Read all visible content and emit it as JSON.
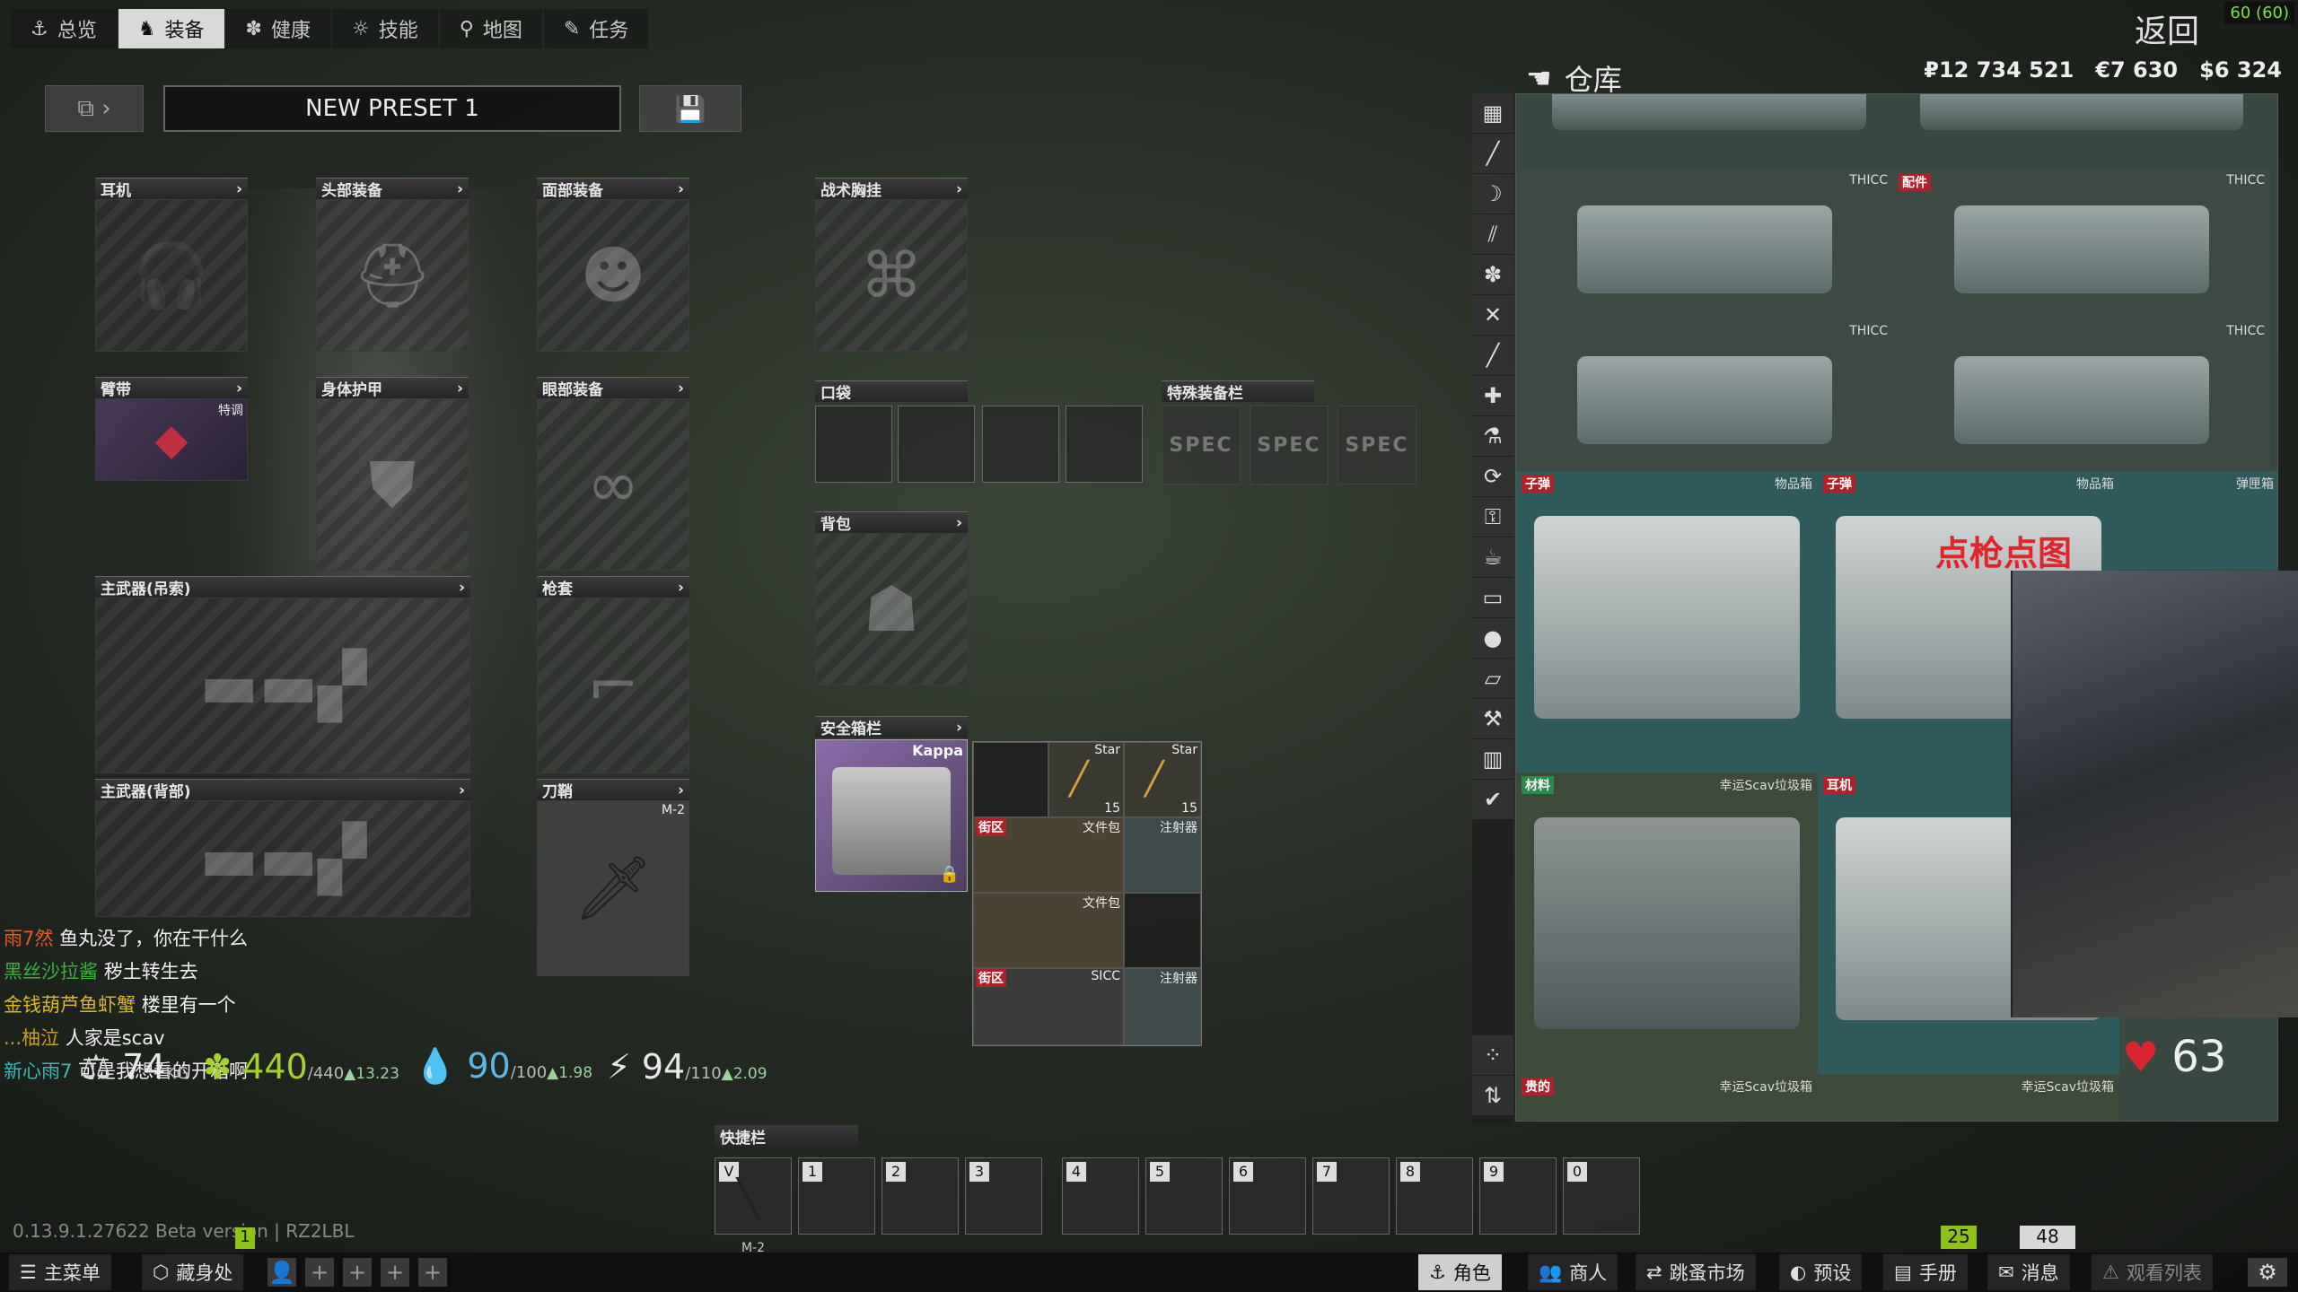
{
  "nav": {
    "tabs": [
      {
        "label": "总览",
        "icon": "overview-icon",
        "glyph": "⚓"
      },
      {
        "label": "装备",
        "icon": "gear-icon",
        "glyph": "♞"
      },
      {
        "label": "健康",
        "icon": "health-icon",
        "glyph": "✽"
      },
      {
        "label": "技能",
        "icon": "skills-icon",
        "glyph": "☼"
      },
      {
        "label": "地图",
        "icon": "map-pin-icon",
        "glyph": "⚲"
      },
      {
        "label": "任务",
        "icon": "tasks-icon",
        "glyph": "✎"
      }
    ],
    "back": "返回",
    "fps": "60 (60)"
  },
  "preset": {
    "name": "NEW PRESET 1"
  },
  "slots": {
    "earpiece": "耳机",
    "headwear": "头部装备",
    "face": "面部装备",
    "rig": "战术胸挂",
    "armband": "臂带",
    "armband_tag": "特调",
    "armor": "身体护甲",
    "eyewear": "眼部装备",
    "pockets": "口袋",
    "special": "特殊装备栏",
    "spec_label": "SPEC",
    "backpack": "背包",
    "primary_sling": "主武器(吊索)",
    "holster": "枪套",
    "secure": "安全箱栏",
    "primary_back": "主武器(背部)",
    "sheath": "刀鞘",
    "sheath_item": "M-2"
  },
  "secure_container": {
    "name": "Kappa",
    "items": {
      "ammo1": {
        "name": "Star",
        "count": "15"
      },
      "ammo2": {
        "name": "Star",
        "count": "15"
      },
      "docs1": {
        "tag": "街区",
        "name": "文件包"
      },
      "inj1": {
        "name": "注射器"
      },
      "docs2": {
        "name": "文件包"
      },
      "sicc": {
        "tag": "街区",
        "name": "SICC"
      },
      "inj2": {
        "name": "注射器"
      }
    }
  },
  "chat": [
    {
      "user": "雨7然",
      "msg": "鱼丸没了，你在干什么"
    },
    {
      "user": "黑丝沙拉酱",
      "msg": "秽土转生去"
    },
    {
      "user": "金钱葫芦鱼虾蟹",
      "msg": "楼里有一个"
    },
    {
      "user": "...柚泣",
      "msg": "人家是scav"
    },
    {
      "user": "新心雨7",
      "msg": "可是我想看的开箱啊"
    }
  ],
  "stats": {
    "weight": "74",
    "weight_unit": "KG",
    "energy": "440",
    "energy_max": "/440",
    "energy_rate": "▲13.23",
    "hydration": "90",
    "hydration_max": "/100",
    "hydration_rate": "▲1.98",
    "stamina": "94",
    "stamina_max": "/110",
    "stamina_rate": "▲2.09"
  },
  "quickbar": {
    "header": "快捷栏",
    "keys": [
      "V",
      "1",
      "2",
      "3",
      "4",
      "5",
      "6",
      "7",
      "8",
      "9",
      "0"
    ],
    "v_item": "M-2"
  },
  "version": "0.13.9.1.27622 Beta version | RZ2LBL",
  "badge_num": "1",
  "counters": {
    "green": "25",
    "gray": "48"
  },
  "bottom": {
    "main_menu": "主菜单",
    "hideout": "藏身处",
    "character": "角色",
    "traders": "商人",
    "flea": "跳蚤市场",
    "presets": "预设",
    "handbook": "手册",
    "messages": "消息",
    "watchlist": "观看列表"
  },
  "stash": {
    "title": "仓库",
    "rub": "₽12 734 521",
    "eur": "€7 630",
    "usd": "$6 324",
    "crates": [
      {
        "tag": "",
        "name": "THICC",
        "tagcolor": "#b0202a"
      },
      {
        "tag": "配件",
        "name": "THICC",
        "tagcolor": "#b0202a"
      },
      {
        "tag": "",
        "name": "THICC",
        "tagcolor": "#b0202a"
      },
      {
        "tag": "",
        "name": "THICC",
        "tagcolor": "#b0202a"
      },
      {
        "tag": "子弹",
        "name": "物品箱",
        "tagcolor": "#b0202a"
      },
      {
        "tag": "子弹",
        "name": "物品箱",
        "tagcolor": "#b0202a"
      },
      {
        "tag": "",
        "name": "弹匣箱",
        "tagcolor": "#b0202a"
      },
      {
        "tag": "材料",
        "name": "幸运Scav垃圾箱",
        "tagcolor": "#2a8a4a"
      },
      {
        "tag": "耳机",
        "name": "",
        "tagcolor": "#b0202a"
      },
      {
        "tag": "贵的",
        "name": "幸运Scav垃圾箱",
        "tagcolor": "#b0202a"
      },
      {
        "tag": "",
        "name": "幸运Scav垃圾箱",
        "tagcolor": "#b0202a"
      }
    ]
  },
  "webcam_title": "点枪点图",
  "health": {
    "value": "63"
  }
}
